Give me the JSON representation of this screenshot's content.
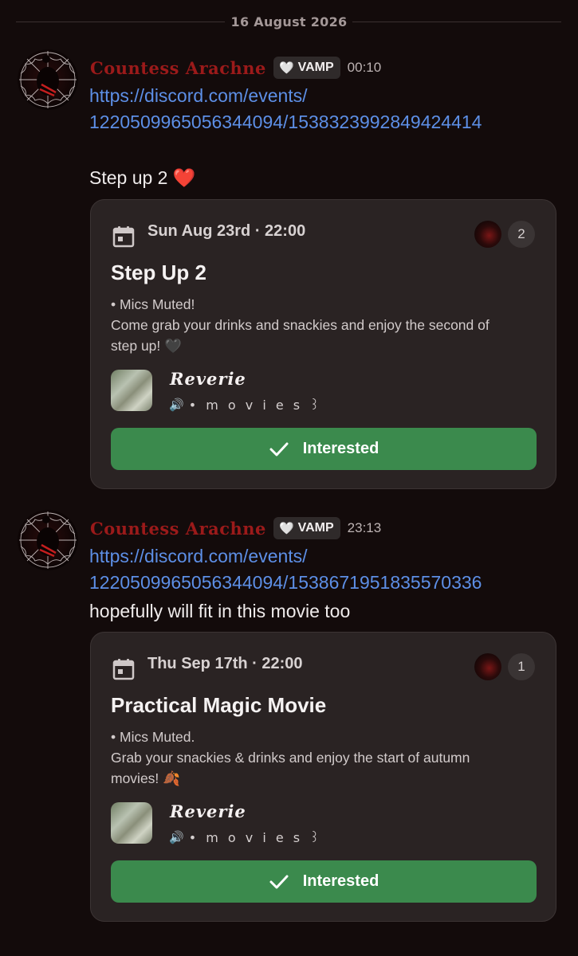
{
  "date_separator": "16 August 2026",
  "messages": [
    {
      "username": "Countess Arachne",
      "tag_icon": "🤍",
      "tag": "VAMP",
      "time": "00:10",
      "link_line1": "https://discord.com/events/",
      "link_line2": "1220509965056344094/1538323992849424414",
      "text": "Step up 2",
      "text_emoji": "❤️",
      "event": {
        "when": "Sun Aug 23rd · 22:00",
        "interested_count": "2",
        "title": "Step Up 2",
        "desc_line1": "• Mics Muted!",
        "desc_line2": "Come grab your drinks and snackies and enjoy the second of",
        "desc_line3": "step up! 🖤",
        "server": "Reverie",
        "channel": "• m o v i e s ꒱",
        "channel_icon": "🔊",
        "button": "Interested"
      }
    },
    {
      "username": "Countess Arachne",
      "tag_icon": "🤍",
      "tag": "VAMP",
      "time": "23:13",
      "link_line1": "https://discord.com/events/",
      "link_line2": "1220509965056344094/1538671951835570336",
      "text": "hopefully will fit in this movie too",
      "event": {
        "when": "Thu Sep 17th · 22:00",
        "interested_count": "1",
        "title": "Practical Magic Movie",
        "desc_line1": "• Mics Muted.",
        "desc_line2": "Grab your snackies & drinks and enjoy the start of autumn",
        "desc_line3": "movies! 🍂",
        "server": "Reverie",
        "channel": "• m o v i e s ꒱",
        "channel_icon": "🔊",
        "button": "Interested"
      }
    }
  ],
  "colors": {
    "background": "#130b0b",
    "username": "#9b1a1a",
    "link": "#5d8fe6",
    "card": "#2a2323",
    "button": "#3b8a4d"
  }
}
